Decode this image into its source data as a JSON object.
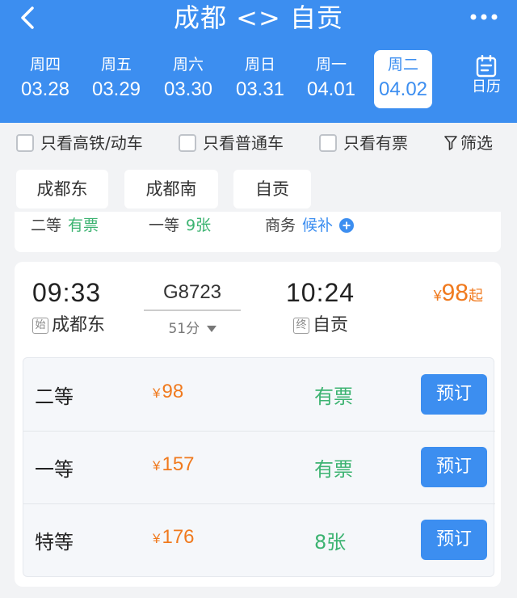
{
  "header": {
    "title": "成都 <> 自贡"
  },
  "date_tabs": [
    {
      "weekday": "周四",
      "date": "03.28",
      "active": false
    },
    {
      "weekday": "周五",
      "date": "03.29",
      "active": false
    },
    {
      "weekday": "周六",
      "date": "03.30",
      "active": false
    },
    {
      "weekday": "周日",
      "date": "03.31",
      "active": false
    },
    {
      "weekday": "周一",
      "date": "04.01",
      "active": false
    },
    {
      "weekday": "周二",
      "date": "04.02",
      "active": true
    }
  ],
  "calendar_label": "日历",
  "filters": {
    "high_speed_only": "只看高铁/动车",
    "regular_only": "只看普通车",
    "available_only": "只看有票",
    "filter_label": "筛选"
  },
  "stations": [
    "成都东",
    "成都南",
    "自贡"
  ],
  "previous_card": {
    "second_class": {
      "label": "二等",
      "status": "有票"
    },
    "first_class": {
      "label": "一等",
      "status": "9张"
    },
    "business": {
      "label": "商务",
      "status": "候补"
    }
  },
  "train": {
    "departure_time": "09:33",
    "departure_tag": "始",
    "departure_station": "成都东",
    "train_number": "G8723",
    "duration": "51分",
    "arrival_time": "10:24",
    "arrival_tag": "终",
    "arrival_station": "自贡",
    "min_price_currency": "¥",
    "min_price": "98",
    "min_price_suffix": "起",
    "seats": [
      {
        "class": "二等",
        "currency": "¥",
        "price": "98",
        "status": "有票",
        "button": "预订"
      },
      {
        "class": "一等",
        "currency": "¥",
        "price": "157",
        "status": "有票",
        "button": "预订"
      },
      {
        "class": "特等",
        "currency": "¥",
        "price": "176",
        "status": "8张",
        "button": "预订"
      }
    ]
  },
  "colors": {
    "primary": "#3c8ef0",
    "price": "#f07a1e",
    "available": "#3cb371"
  }
}
